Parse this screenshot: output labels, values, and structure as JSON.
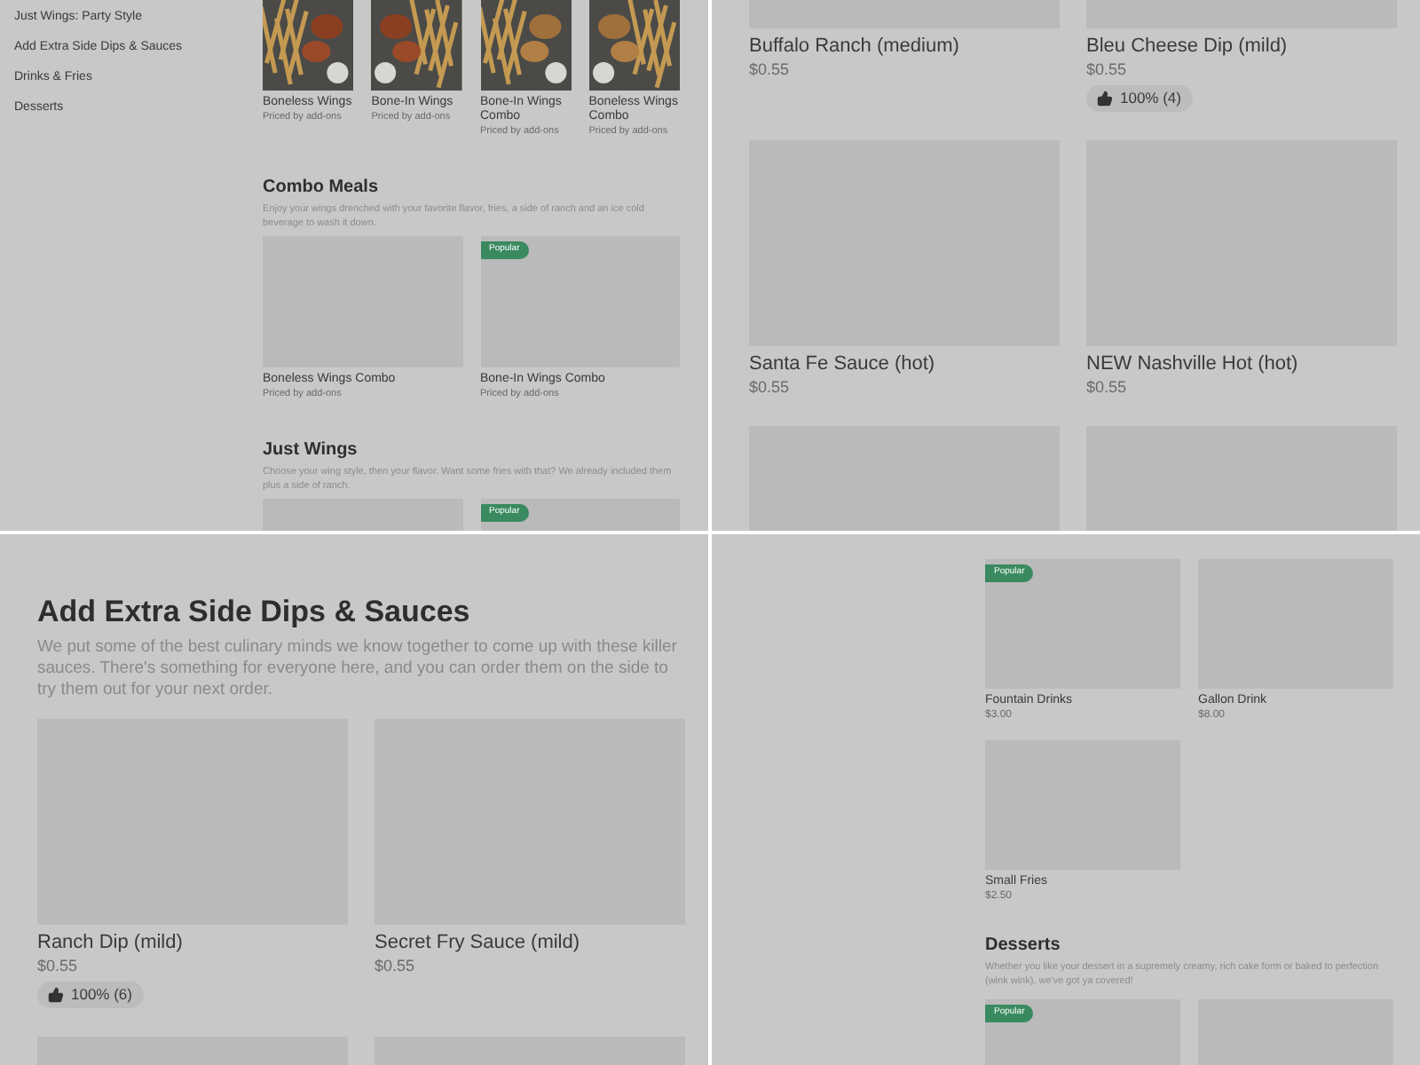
{
  "panels": [
    {
      "kind": "narrow",
      "sidebar": {
        "items": [
          {
            "label": "Just Wings: Party Style"
          },
          {
            "label": "Add Extra Side Dips & Sauces"
          },
          {
            "label": "Drinks & Fries"
          },
          {
            "label": "Desserts"
          }
        ]
      },
      "sections": [
        {
          "kind": "carousel",
          "items": [
            {
              "name": "Boneless Wings",
              "note": "Priced by add-ons"
            },
            {
              "name": "Bone-In Wings",
              "note": "Priced by add-ons"
            },
            {
              "name": "Bone-In Wings Combo",
              "note": "Priced by add-ons"
            },
            {
              "name": "Boneless Wings Combo",
              "note": "Priced by add-ons"
            }
          ]
        },
        {
          "kind": "grid",
          "title": "Combo Meals",
          "description": "Enjoy your wings drenched with your favorite flavor, fries, a side of ranch and an ice cold beverage to wash it down.",
          "items": [
            {
              "kind": "placeholder",
              "name": "Boneless Wings Combo",
              "note": "Priced by add-ons"
            },
            {
              "kind": "placeholder",
              "badge": "Popular",
              "name": "Bone-In Wings Combo",
              "note": "Priced by add-ons"
            }
          ]
        },
        {
          "kind": "grid",
          "title": "Just Wings",
          "description": "Choose your wing style, then your flavor. Want some fries with that? We already included them plus a side of ranch.",
          "items": [
            {
              "kind": "placeholder"
            },
            {
              "kind": "placeholder",
              "badge": "Popular"
            }
          ]
        }
      ]
    },
    {
      "kind": "wide",
      "sections": [
        {
          "kind": "grid",
          "items": [
            {
              "kind": "placeholder",
              "name": "Buffalo Ranch (medium)",
              "price": "$0.55"
            },
            {
              "kind": "placeholder",
              "name": "Bleu Cheese Dip (mild)",
              "price": "$0.55",
              "rating": "100% (4)"
            },
            {
              "kind": "placeholder",
              "name": "Santa Fe Sauce (hot)",
              "price": "$0.55"
            },
            {
              "kind": "placeholder",
              "name": "NEW Nashville Hot (hot)",
              "price": "$0.55"
            },
            {
              "kind": "placeholder"
            },
            {
              "kind": "placeholder"
            }
          ]
        }
      ]
    },
    {
      "kind": "wide",
      "sections": [
        {
          "kind": "grid",
          "title": "Add Extra Side Dips & Sauces",
          "description": "We put some of the best culinary minds we know together to come up with these killer sauces. There's something for everyone here, and you can order them on the side to try them out for your next order.",
          "items": [
            {
              "kind": "placeholder",
              "name": "Ranch Dip (mild)",
              "price": "$0.55",
              "rating": "100% (6)"
            },
            {
              "kind": "placeholder",
              "name": "Secret Fry Sauce (mild)",
              "price": "$0.55"
            },
            {
              "kind": "placeholder"
            },
            {
              "kind": "placeholder"
            }
          ]
        }
      ]
    },
    {
      "kind": "compact",
      "sections": [
        {
          "kind": "grid",
          "items": [
            {
              "kind": "placeholder",
              "badge": "Popular",
              "name": "Fountain Drinks",
              "price": "$3.00"
            },
            {
              "kind": "placeholder",
              "name": "Gallon Drink",
              "price": "$8.00"
            },
            {
              "kind": "placeholder",
              "name": "Small Fries",
              "price": "$2.50"
            }
          ]
        },
        {
          "kind": "grid",
          "title": "Desserts",
          "description": "Whether you like your dessert in a supremely creamy, rich cake form or baked to perfection (wink wink), we've got ya covered!",
          "items": [
            {
              "kind": "placeholder",
              "badge": "Popular"
            },
            {
              "kind": "placeholder"
            }
          ]
        }
      ]
    }
  ]
}
